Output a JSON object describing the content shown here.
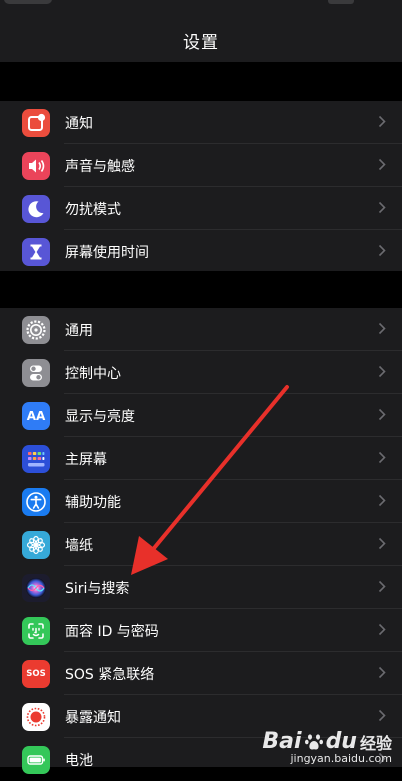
{
  "header": {
    "title": "设置"
  },
  "groups": [
    {
      "items": [
        {
          "label": "通知",
          "icon": "notification-icon",
          "color": "#eb4d3d"
        },
        {
          "label": "声音与触感",
          "icon": "speaker-icon",
          "color": "#eb445a"
        },
        {
          "label": "勿扰模式",
          "icon": "moon-icon",
          "color": "#5856d6"
        },
        {
          "label": "屏幕使用时间",
          "icon": "hourglass-icon",
          "color": "#5856d6"
        }
      ]
    },
    {
      "items": [
        {
          "label": "通用",
          "icon": "gear-icon",
          "color": "#8e8e93"
        },
        {
          "label": "控制中心",
          "icon": "switches-icon",
          "color": "#8e8e93"
        },
        {
          "label": "显示与亮度",
          "icon": "display-aa-icon",
          "color": "#2f7cf6",
          "icon_text": "AA"
        },
        {
          "label": "主屏幕",
          "icon": "home-screen-grid-icon",
          "color": "#2c4fd8"
        },
        {
          "label": "辅助功能",
          "icon": "accessibility-icon",
          "color": "#1a7bf0"
        },
        {
          "label": "墙纸",
          "icon": "flower-icon",
          "color": "#36a9d8"
        },
        {
          "label": "Siri与搜索",
          "icon": "siri-icon",
          "color": "#1c1c2e"
        },
        {
          "label": "面容 ID 与密码",
          "icon": "face-id-icon",
          "color": "#34c759"
        },
        {
          "label": "SOS 紧急联络",
          "icon": "sos-icon",
          "color": "#eb3b30",
          "icon_text": "SOS"
        },
        {
          "label": "暴露通知",
          "icon": "exposure-icon",
          "color": "#ffffff"
        },
        {
          "label": "电池",
          "icon": "battery-icon",
          "color": "#34c759"
        }
      ]
    }
  ],
  "annotation": {
    "color": "#e8302a"
  },
  "watermark": {
    "brand": "Bai",
    "brand2": "du",
    "cn": "经验",
    "url": "jingyan.baidu.com"
  }
}
